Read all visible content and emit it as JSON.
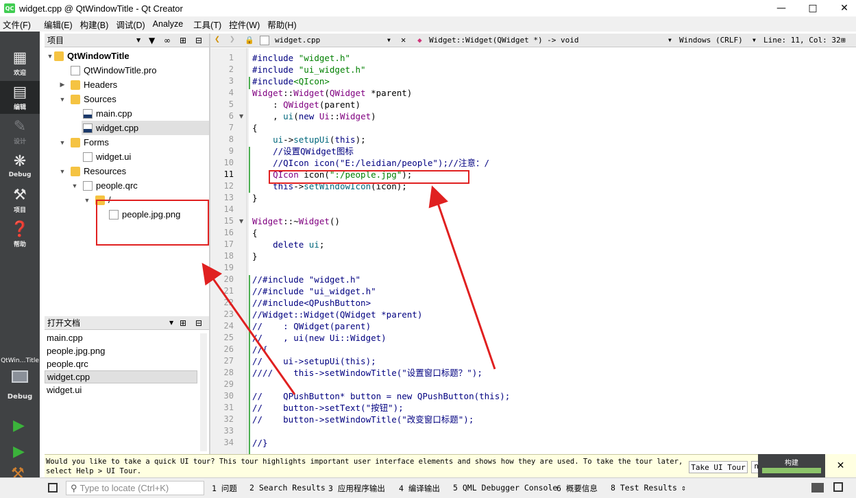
{
  "window": {
    "title": "widget.cpp @ QtWindowTitle - Qt Creator",
    "app_icon": "QC"
  },
  "menu": [
    "文件(F)",
    "编辑(E)",
    "构建(B)",
    "调试(D)",
    "Analyze",
    "工具(T)",
    "控件(W)",
    "帮助(H)"
  ],
  "modes": [
    {
      "label": "欢迎",
      "icon": "grid-icon"
    },
    {
      "label": "编辑",
      "icon": "edit-icon"
    },
    {
      "label": "设计",
      "icon": "pencil-icon"
    },
    {
      "label": "Debug",
      "icon": "bug-icon"
    },
    {
      "label": "项目",
      "icon": "wrench-icon"
    },
    {
      "label": "帮助",
      "icon": "help-icon"
    }
  ],
  "kit": {
    "name": "QtWin…Title",
    "config": "Debug"
  },
  "project_panel": {
    "title": "项目",
    "tree": [
      {
        "label": "QtWindowTitle",
        "level": 0,
        "expanded": true,
        "bold": true,
        "kind": "project"
      },
      {
        "label": "QtWindowTitle.pro",
        "level": 1,
        "kind": "file"
      },
      {
        "label": "Headers",
        "level": 1,
        "expanded": false,
        "kind": "folder"
      },
      {
        "label": "Sources",
        "level": 1,
        "expanded": true,
        "kind": "folder"
      },
      {
        "label": "main.cpp",
        "level": 2,
        "kind": "cpp"
      },
      {
        "label": "widget.cpp",
        "level": 2,
        "kind": "cpp",
        "selected": true
      },
      {
        "label": "Forms",
        "level": 1,
        "expanded": true,
        "kind": "folder"
      },
      {
        "label": "widget.ui",
        "level": 2,
        "kind": "file"
      },
      {
        "label": "Resources",
        "level": 1,
        "expanded": true,
        "kind": "folder"
      },
      {
        "label": "people.qrc",
        "level": 2,
        "expanded": true,
        "kind": "file"
      },
      {
        "label": "/",
        "level": 3,
        "expanded": true,
        "kind": "folder"
      },
      {
        "label": "people.jpg.png",
        "level": 4,
        "kind": "file"
      }
    ]
  },
  "open_documents": {
    "title": "打开文档",
    "items": [
      "main.cpp",
      "people.jpg.png",
      "people.qrc",
      "widget.cpp",
      "widget.ui"
    ],
    "selected": "widget.cpp"
  },
  "editor": {
    "file": "widget.cpp",
    "symbol": "Widget::Widget(QWidget *) -> void",
    "line_ending": "Windows (CRLF)",
    "position": "Line: 11, Col: 32",
    "current_line": 11,
    "lines": [
      "#include \"widget.h\"",
      "#include \"ui_widget.h\"",
      "#include<QIcon>",
      "Widget::Widget(QWidget *parent)",
      "    : QWidget(parent)",
      "    , ui(new Ui::Widget)",
      "{",
      "    ui->setupUi(this);",
      "    //设置QWidget图标",
      "    //QIcon icon(\"E:/leidian/people\");//注意：/",
      "    QIcon icon(\":/people.jpg\");",
      "    this->setWindowIcon(icon);",
      "}",
      "",
      "Widget::~Widget()",
      "{",
      "    delete ui;",
      "}",
      "",
      "//#include \"widget.h\"",
      "//#include \"ui_widget.h\"",
      "//#include<QPushButton>",
      "//Widget::Widget(QWidget *parent)",
      "//    : QWidget(parent)",
      "//    , ui(new Ui::Widget)",
      "//{",
      "//    ui->setupUi(this);",
      "////    this->setWindowTitle(\"设置窗口标题？\");",
      "",
      "//    QPushButton* button = new QPushButton(this);",
      "//    button->setText(\"按钮\");",
      "//    button->setWindowTitle(\"改变窗口标题\");",
      "",
      "//}"
    ]
  },
  "tour": {
    "message": "Would you like to take a quick UI tour? This tour highlights important user interface elements and shows how they are used. To take the tour later, select Help > UI Tour.",
    "button": "Take UI Tour",
    "partial_button": "n"
  },
  "build_progress": {
    "label": "构建",
    "fraction": 1.0
  },
  "status": {
    "locate_placeholder": "Type to locate (Ctrl+K)",
    "panes": [
      "1 问题",
      "2 Search Results",
      "3 应用程序输出",
      "4 编译输出",
      "5 QML Debugger Console",
      "6 概要信息",
      "8 Test Results"
    ]
  },
  "colors": {
    "annotation": "#e02020",
    "modebar": "#404244",
    "string": "#008000",
    "preprocessor": "#000080"
  }
}
